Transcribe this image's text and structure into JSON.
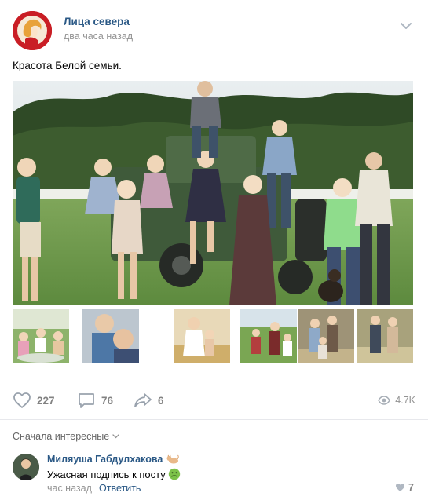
{
  "post": {
    "group_name": "Лица севера",
    "time": "два часа назад",
    "text": "Красота Белой семьи.",
    "menu_icon": "chevron-down-icon"
  },
  "actions": {
    "likes": "227",
    "comments": "76",
    "shares": "6",
    "views": "4.7K"
  },
  "comments_section": {
    "sort_label": "Сначала интересные",
    "items": [
      {
        "author": "Миляуша Габдулхакова",
        "text": "Ужасная подпись к посту",
        "time": "час назад",
        "reply_label": "Ответить",
        "likes": "7"
      }
    ]
  },
  "colors": {
    "link": "#2a5885",
    "meta": "#939393",
    "icon": "#99a2ad",
    "avatar_red": "#c91e25"
  }
}
